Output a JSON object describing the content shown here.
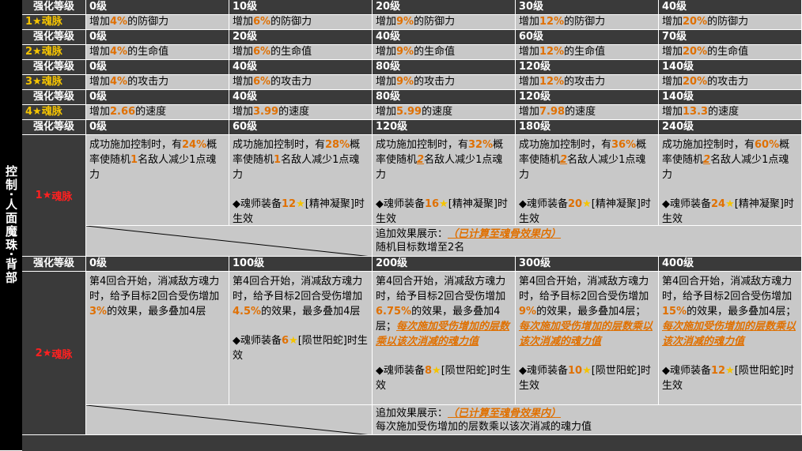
{
  "side_title": "控制·人面魔珠·背部",
  "strengthen_label": "强化等级",
  "rows1": [
    {
      "levels": [
        "0级",
        "10级",
        "20级",
        "30级",
        "40级"
      ],
      "tag": "1★魂脉",
      "cells": [
        [
          "增加",
          "4%",
          "的防御力"
        ],
        [
          "增加",
          "6%",
          "的防御力"
        ],
        [
          "增加",
          "9%",
          "的防御力"
        ],
        [
          "增加",
          "12%",
          "的防御力"
        ],
        [
          "增加",
          "20%",
          "的防御力"
        ]
      ]
    },
    {
      "levels": [
        "0级",
        "20级",
        "40级",
        "60级",
        "70级"
      ],
      "tag": "2★魂脉",
      "cells": [
        [
          "增加",
          "4%",
          "的生命值"
        ],
        [
          "增加",
          "6%",
          "的生命值"
        ],
        [
          "增加",
          "9%",
          "的生命值"
        ],
        [
          "增加",
          "12%",
          "的生命值"
        ],
        [
          "增加",
          "20%",
          "的生命值"
        ]
      ]
    },
    {
      "levels": [
        "0级",
        "40级",
        "80级",
        "120级",
        "140级"
      ],
      "tag": "3★魂脉",
      "cells": [
        [
          "增加",
          "4%",
          "的攻击力"
        ],
        [
          "增加",
          "6%",
          "的攻击力"
        ],
        [
          "增加",
          "9%",
          "的攻击力"
        ],
        [
          "增加",
          "12%",
          "的攻击力"
        ],
        [
          "增加",
          "20%",
          "的攻击力"
        ]
      ]
    },
    {
      "levels": [
        "0级",
        "40级",
        "80级",
        "120级",
        "140级"
      ],
      "tag": "4★魂脉",
      "cells": [
        [
          "增加",
          "2.66",
          "的速度"
        ],
        [
          "增加",
          "3.99",
          "的速度"
        ],
        [
          "增加",
          "5.99",
          "的速度"
        ],
        [
          "增加",
          "7.98",
          "的速度"
        ],
        [
          "增加",
          "13.3",
          "的速度"
        ]
      ]
    }
  ],
  "block1": {
    "levels": [
      "0级",
      "60级",
      "120级",
      "180级",
      "240级"
    ],
    "soul": "1★魂脉",
    "cells": [
      {
        "a": "成功施加控制时，有",
        "p": "24%",
        "b": "概率使随机",
        "n": "1",
        "c": "名敌人减少1点魂力",
        "equip": ""
      },
      {
        "a": "成功施加控制时，有",
        "p": "28%",
        "b": "概率使随机",
        "n": "1",
        "c": "名敌人减少1点魂力",
        "equip_pre": "◆魂师装备",
        "equip_num": "12",
        "equip_post": "[精神凝聚]时生效"
      },
      {
        "a": "成功施加控制时，有",
        "p": "32%",
        "b": "概率使随机",
        "n": "2",
        "c": "名敌人减少1点魂力",
        "equip_pre": "◆魂师装备",
        "equip_num": "16",
        "equip_post": "[精神凝聚]时生效"
      },
      {
        "a": "成功施加控制时，有",
        "p": "36%",
        "b": "概率使随机",
        "n": "2",
        "c": "名敌人减少1点魂力",
        "equip_pre": "◆魂师装备",
        "equip_num": "20",
        "equip_post": "[精神凝聚]时生效"
      },
      {
        "a": "成功施加控制时，有",
        "p": "60%",
        "b": "概率使随机",
        "n": "2",
        "c": "名敌人减少1点魂力",
        "equip_pre": "◆魂师装备",
        "equip_num": "24",
        "equip_post": "[精神凝聚]时生效"
      }
    ],
    "note_label": "追加效果展示：",
    "note_em": "（已计算至魂骨效果内）",
    "note_text": "随机目标数增至2名"
  },
  "block2": {
    "levels": [
      "0级",
      "100级",
      "200级",
      "300级",
      "400级"
    ],
    "soul": "2★魂脉",
    "base": "第4回合开始，消减敌方魂力时，给予目标2回合受伤增加",
    "pcts": [
      "3%",
      "4.5%",
      "6.75%",
      "9%",
      "15%"
    ],
    "tail": "的效果，最多叠加4层",
    "extra": "每次施加受伤增加的层数乘以该次消减的魂力值",
    "equip_pre": "◆魂师装备",
    "equip_nums": [
      "",
      "6",
      "8",
      "10",
      "12"
    ],
    "equip_post": "[陨世阳蛇]时生效",
    "note_label": "追加效果展示：",
    "note_em": "（已计算至魂骨效果内）",
    "note_text": "每次施加受伤增加的层数乘以该次消减的魂力值"
  }
}
